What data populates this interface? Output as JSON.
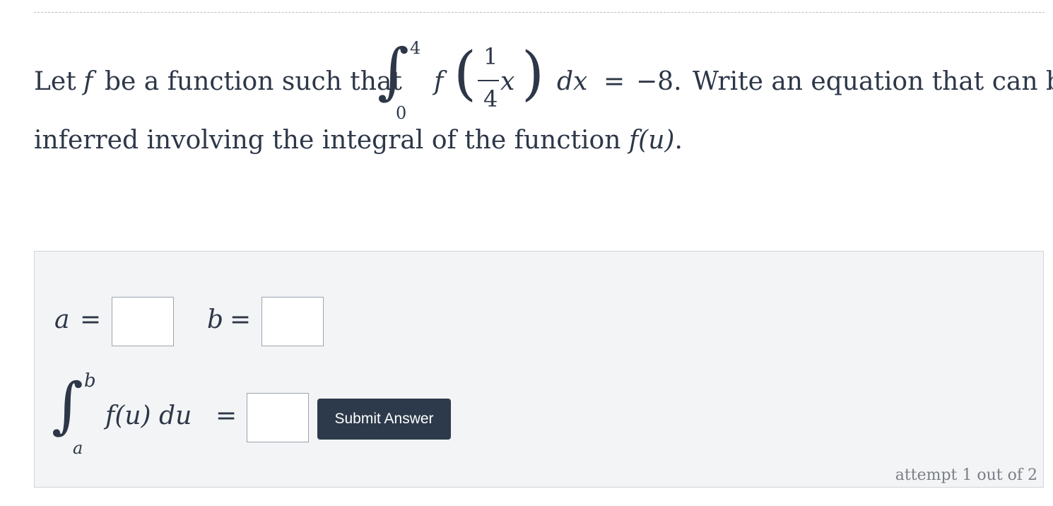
{
  "question": {
    "line1_prefix": "Let",
    "var_f": "f",
    "line1_mid": "be a function such that",
    "integral_upper": "4",
    "integral_lower": "0",
    "integrand_f": "f",
    "frac_num": "1",
    "frac_den": "4",
    "var_x": "x",
    "dx": "dx",
    "equals": "=",
    "result": "−8.",
    "line1_suffix": "Write an equation that can be",
    "line2_text": "inferred involving the integral of the function",
    "line2_func": "f",
    "line2_arg": "(u)",
    "line2_end": "."
  },
  "answer": {
    "a_label": "a",
    "b_label": "b",
    "eq": "=",
    "int_upper": "b",
    "int_lower": "a",
    "integrand": "f(u) du",
    "submit_label": "Submit Answer",
    "attempt_text": "attempt 1 out of 2"
  }
}
